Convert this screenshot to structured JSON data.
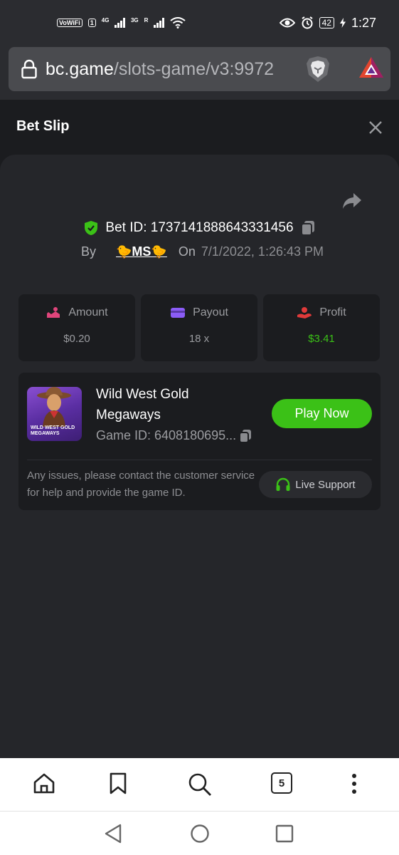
{
  "status_bar": {
    "vowifi": "VoWiFi",
    "sim": "1",
    "net1": "4G",
    "net2": "3G",
    "net2_sub": "R",
    "battery": "42",
    "time": "1:27"
  },
  "browser": {
    "url_host": "bc.game",
    "url_path": "/slots-game/v3:9972",
    "tab_count": "5"
  },
  "bet_slip": {
    "title": "Bet Slip",
    "bet_id": "Bet ID: 1737141888643331456",
    "by_label": "By",
    "user": "🐤MS🐤",
    "on_label": "On",
    "date": "7/1/2022, 1:26:43 PM",
    "stats": [
      {
        "label": "Amount",
        "value": "$0.20",
        "color": "#e0457b"
      },
      {
        "label": "Payout",
        "value": "18 x",
        "color": "#8b5cf6"
      },
      {
        "label": "Profit",
        "value": "$3.41",
        "color": "#e03a3a"
      }
    ],
    "game": {
      "name": "Wild West Gold Megaways",
      "id": "Game ID: 6408180695...",
      "thumb_text": "WILD WEST GOLD MEGAWAYS",
      "play_label": "Play Now",
      "issue_text": "Any issues, please contact the customer service for help and provide the game ID.",
      "support_label": "Live Support"
    }
  },
  "colors": {
    "accent_green": "#3bc117",
    "panel": "#25262a",
    "card": "#1b1c1f"
  }
}
